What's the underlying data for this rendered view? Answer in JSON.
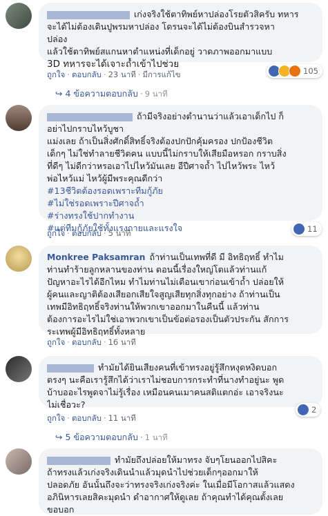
{
  "comments": [
    {
      "lines": [
        "เก่งจริงใช้ตาทิพย์หาปล่องโรยตัวสิครับ ทหาร",
        "จะได้ไม่ต้องเดินปูพรมหาปล่อง โดรนจะได้ไม่ต้องบินสำรวจหา",
        "ปล่อง",
        "แล้วใช้ตาทิพย์สแกนหาตำแหน่งที่เด็กอยู่ วาดภาพออกมาแบบ",
        "3D ทหารจะได้เจาะถ้ำเข้าไปช่วย"
      ],
      "like": "ถูกใจ",
      "reply": "ตอบกลับ",
      "time": "23 นาที",
      "edited": "มีการแก้ไข",
      "reaction_count": "105",
      "replies_link": "4 ข้อความตอบกลับ",
      "replies_time": "9 นาที"
    },
    {
      "lines": [
        "ถ้ามีจริงอย่างตำนานว่าแล้วเอาเด็กไป ก็",
        "อย่าไปกราบไหว้บูชา",
        "แม่งเลย ถ้าเป็นสิ่งศักดิ์สิทธิ์จริงต้องปกปักคุ้มครอง ปกป้องชีวิต",
        "เด็กๆ ไม่ใช่ทำลายชีวิตคน แบบนี้ไม่กราบให้เสียมือหรอก กราบสิ่ง",
        "ที่ดีๆ ไม่ดีกว่าหรอเอาไปไหว้มันเลย อีปีศาจถ้ำ ไปไหว้พระ ไหว้",
        "พ่อไหว้แม่ ไหว้ผู้มีพระคุณดีกว่า"
      ],
      "tags": [
        "#13ชีวิตต้องรอดเพราะทีมกู้ภัย",
        "#ไม่ใช่รอดเพราะปีศาจถ้ำ",
        "#ร่างทรงใช้ปากทำงาน",
        "#แต่ทีมกู้ภัยใช้ทั้งแรงกายและแรงใจ"
      ],
      "like": "ถูกใจ",
      "reply": "ตอบกลับ",
      "time": "5 นาที",
      "reaction_count": "11"
    },
    {
      "name": "Monkree Paksamran",
      "lines": [
        "ถ้าท่านเป็นเทพที่ดี มี อิทธิฤทธิ์ ทำไม",
        "ท่านทำร้ายลูกหลานของท่าน ตอนนี้เรื่องใหญ่โตแล้วท่านแก้",
        "ปัญหาอะไรได้อีกไหม ทำไมท่านไม่เตือนเขาก่อนเข้าถ้ำ ปล่อยให้",
        "ผู้คนและญาติต้องเสียอกเสียใจสูญเสียทุกสิ่งทุกอย่าง ถ้าท่านเป็น",
        "เทพมีอิทธิฤทธิ์จริงท่านให้พวกเขาออกมาในคืนนี้ แล้วท่าน",
        "ต้องการอะไรไม่ใช่เอาพวกเขาเป็นข้อต่อรองเป็นตัวประกัน สักการ",
        "ระเทพผู้มีอิทธิฤทธิ์ทั้งหลาย"
      ],
      "like": "ถูกใจ",
      "reply": "ตอบกลับ",
      "time": "16 นาที"
    },
    {
      "lines": [
        "ทำมัยได้ยินเสียงคนที่เข้าทรงอยู่รู้สึกหงุดหงิดบอก",
        "ตรงๆ นะคือเรารู้สึกได้ว่าเราไม่ชอบการกระทำที่นางทำอยู่นะ พูด",
        "บ้าบออะไรพูดจาไม่รู้เรื่อง เหมือนคนเมาคนสติแตกอ่ะ เอาจริงนะ",
        "ไม่เชื่อวะ?"
      ],
      "like": "ถูกใจ",
      "reply": "ตอบกลับ",
      "time": "11 นาที",
      "reaction_count": "2",
      "replies_link": "5 ข้อความตอบกลับ",
      "replies_time": "1 นาที"
    },
    {
      "lines": [
        "ทำมัยถึงปล่อยให้มาทรง จับๆโยนออกไปสิคะ",
        "ถ้าทรงแล้วเก่งจริงเดินนำแล้วมุดนำไปช่วยเด็กๆออกมาให้",
        "ปลอดภัย อันนั้นถึงจะว่าทรงจริงเก่งจริงค่ะ ในเมื่อมีโอกาสแล้วแสดง",
        "อภินิหารเลยสิคะมุดนำ ดำอากาศให้ดูเลย ถ้าคุณทำได้คุณตั้งเลย",
        "ขอบอก"
      ]
    }
  ],
  "colors": {
    "link": "#385898",
    "bubble": "#f2f3f5",
    "like": "#4267b2",
    "haha": "#f7b125",
    "angry": "#e9710f"
  },
  "icons": {
    "reply_arrow": "↪",
    "like": "like-icon",
    "haha": "haha-icon",
    "angry": "angry-icon"
  }
}
